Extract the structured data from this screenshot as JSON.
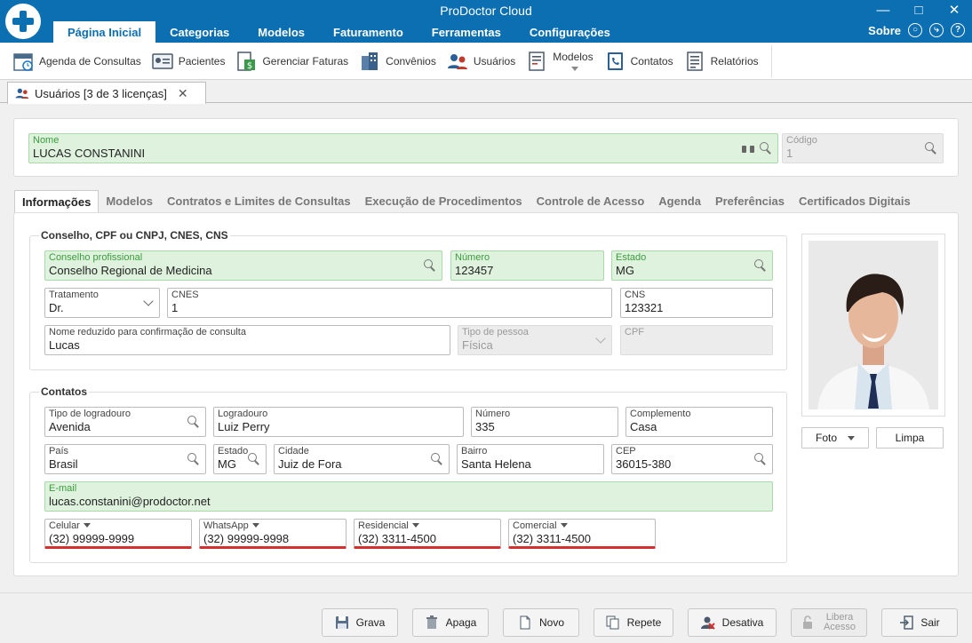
{
  "app": {
    "title": "ProDoctor Cloud"
  },
  "menu": {
    "tabs": [
      "Página Inicial",
      "Categorias",
      "Modelos",
      "Faturamento",
      "Ferramentas",
      "Configurações"
    ],
    "about": "Sobre"
  },
  "toolbar": {
    "items": [
      "Agenda de Consultas",
      "Pacientes",
      "Gerenciar Faturas",
      "Convênios",
      "Usuários",
      "Modelos",
      "Contatos",
      "Relatórios"
    ]
  },
  "doctab": {
    "label": "Usuários [3 de 3 licenças]"
  },
  "user": {
    "name_label": "Nome",
    "name": "LUCAS CONSTANINI",
    "code_label": "Código",
    "code": "1"
  },
  "subtabs": [
    "Informações",
    "Modelos",
    "Contratos e Limites de Consultas",
    "Execução de Procedimentos",
    "Controle de Acesso",
    "Agenda",
    "Preferências",
    "Certificados Digitais"
  ],
  "conselho": {
    "title": "Conselho, CPF ou CNPJ, CNES, CNS",
    "prof_label": "Conselho profissional",
    "prof": "Conselho Regional de Medicina",
    "numero_label": "Número",
    "numero": "123457",
    "estado_label": "Estado",
    "estado": "MG",
    "trat_label": "Tratamento",
    "trat": "Dr.",
    "cnes_label": "CNES",
    "cnes": "1",
    "cns_label": "CNS",
    "cns": "123321",
    "nome_red_label": "Nome reduzido para confirmação de consulta",
    "nome_red": "Lucas",
    "tipo_pessoa_label": "Tipo de pessoa",
    "tipo_pessoa": "Física",
    "cpf_label": "CPF",
    "cpf": ""
  },
  "contatos": {
    "title": "Contatos",
    "tipo_log_label": "Tipo de logradouro",
    "tipo_log": "Avenida",
    "logradouro_label": "Logradouro",
    "logradouro": "Luiz Perry",
    "numero_label": "Número",
    "numero": "335",
    "complemento_label": "Complemento",
    "complemento": "Casa",
    "pais_label": "País",
    "pais": "Brasil",
    "estado_label": "Estado",
    "estado": "MG",
    "cidade_label": "Cidade",
    "cidade": "Juiz de Fora",
    "bairro_label": "Bairro",
    "bairro": "Santa Helena",
    "cep_label": "CEP",
    "cep": "36015-380",
    "email_label": "E-mail",
    "email": "lucas.constanini@prodoctor.net",
    "celular_label": "Celular",
    "celular": "(32) 99999-9999",
    "whatsapp_label": "WhatsApp",
    "whatsapp": "(32) 99999-9998",
    "residencial_label": "Residencial",
    "residencial": "(32) 3311-4500",
    "comercial_label": "Comercial",
    "comercial": "(32) 3311-4500"
  },
  "photo": {
    "foto_label": "Foto",
    "limpa_label": "Limpa"
  },
  "actions": {
    "grava": "Grava",
    "apaga": "Apaga",
    "novo": "Novo",
    "repete": "Repete",
    "desativa": "Desativa",
    "libera": "Libera Acesso",
    "sair": "Sair"
  },
  "colors": {
    "accent": "#0b6fb2",
    "required_bg": "#def2de",
    "phone_underline": "#d62f2f"
  }
}
